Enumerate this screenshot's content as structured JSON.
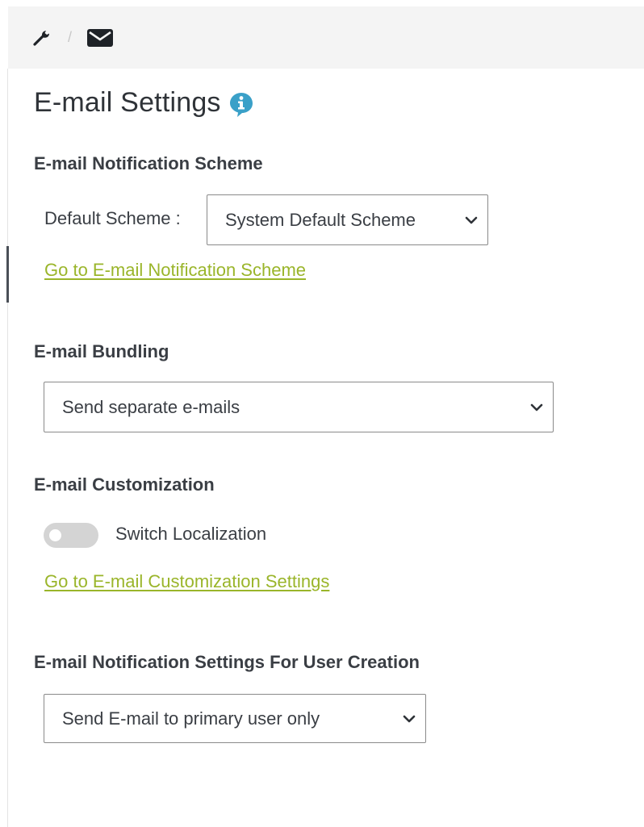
{
  "breadcrumb": {
    "items": [
      {
        "icon": "wrench-icon"
      },
      {
        "icon": "envelope-icon"
      }
    ],
    "separator": "/"
  },
  "page": {
    "title": "E-mail Settings",
    "info_icon": "info-icon"
  },
  "notification_scheme": {
    "heading": "E-mail Notification Scheme",
    "label": "Default Scheme :",
    "selected": "System Default Scheme",
    "link": "Go to E-mail Notification Scheme"
  },
  "bundling": {
    "heading": "E-mail Bundling",
    "selected": "Send separate e-mails"
  },
  "customization": {
    "heading": "E-mail Customization",
    "toggle_label": "Switch Localization",
    "toggle_on": false,
    "link": "Go to E-mail Customization Settings"
  },
  "user_creation": {
    "heading": "E-mail Notification Settings For User Creation",
    "selected": "Send E-mail to primary user only"
  },
  "colors": {
    "link": "#9ab52a",
    "info_icon": "#3aa0c8",
    "topbar_bg": "#f4f4f4",
    "toggle_off": "#d4d4d4"
  }
}
